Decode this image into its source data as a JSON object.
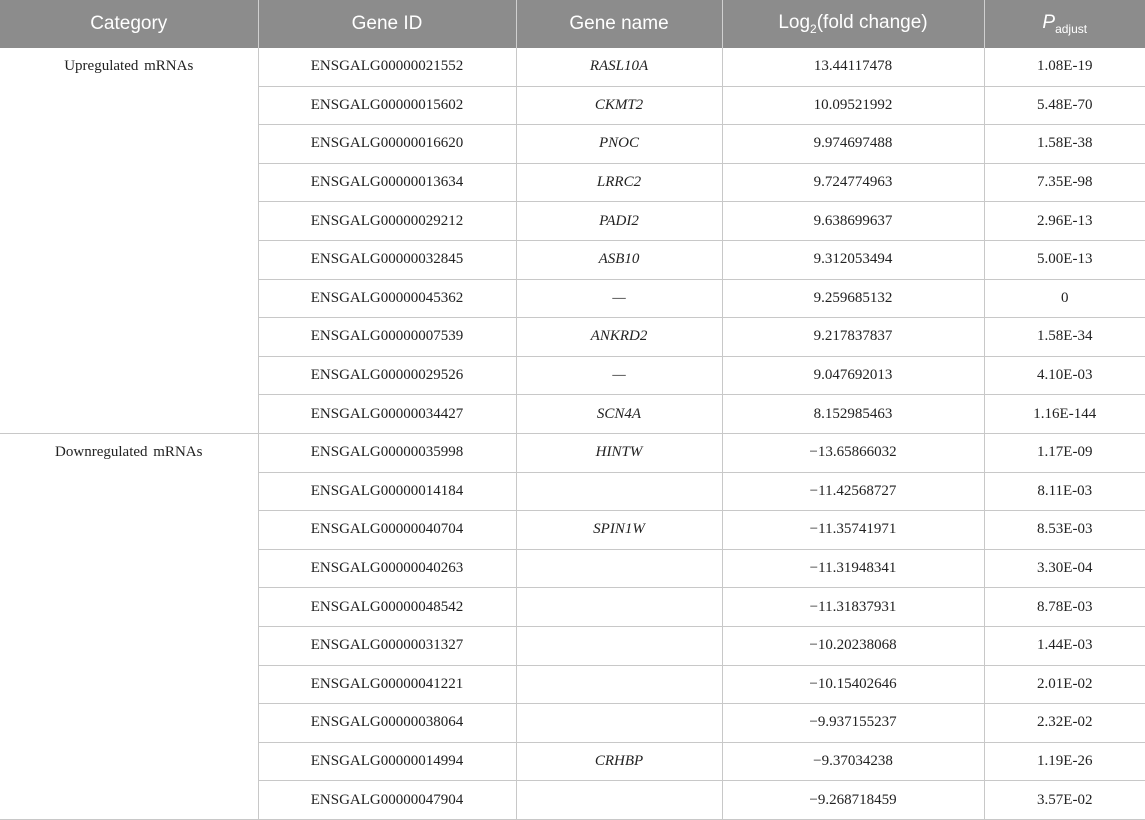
{
  "table": {
    "headers": {
      "category": "Category",
      "gene_id": "Gene ID",
      "gene_name": "Gene name",
      "log2_prefix": "Log",
      "log2_sub": "2",
      "log2_suffix": "(fold change)",
      "padj_main": "P",
      "padj_sub": "adjust"
    },
    "groups": [
      {
        "category": "Upregulated mRNAs",
        "rows": [
          {
            "gene_id": "ENSGALG00000021552",
            "gene_name": "RASL10A",
            "log2fc": "13.44117478",
            "padj": "1.08E-19"
          },
          {
            "gene_id": "ENSGALG00000015602",
            "gene_name": "CKMT2",
            "log2fc": "10.09521992",
            "padj": "5.48E-70"
          },
          {
            "gene_id": "ENSGALG00000016620",
            "gene_name": "PNOC",
            "log2fc": "9.974697488",
            "padj": "1.58E-38"
          },
          {
            "gene_id": "ENSGALG00000013634",
            "gene_name": "LRRC2",
            "log2fc": "9.724774963",
            "padj": "7.35E-98"
          },
          {
            "gene_id": "ENSGALG00000029212",
            "gene_name": "PADI2",
            "log2fc": "9.638699637",
            "padj": "2.96E-13"
          },
          {
            "gene_id": "ENSGALG00000032845",
            "gene_name": "ASB10",
            "log2fc": "9.312053494",
            "padj": "5.00E-13"
          },
          {
            "gene_id": "ENSGALG00000045362",
            "gene_name": "—",
            "log2fc": "9.259685132",
            "padj": "0"
          },
          {
            "gene_id": "ENSGALG00000007539",
            "gene_name": "ANKRD2",
            "log2fc": "9.217837837",
            "padj": "1.58E-34"
          },
          {
            "gene_id": "ENSGALG00000029526",
            "gene_name": "—",
            "log2fc": "9.047692013",
            "padj": "4.10E-03"
          },
          {
            "gene_id": "ENSGALG00000034427",
            "gene_name": "SCN4A",
            "log2fc": "8.152985463",
            "padj": "1.16E-144"
          }
        ]
      },
      {
        "category": "Downregulated mRNAs",
        "rows": [
          {
            "gene_id": "ENSGALG00000035998",
            "gene_name": "HINTW",
            "log2fc": "−13.65866032",
            "padj": "1.17E-09"
          },
          {
            "gene_id": "ENSGALG00000014184",
            "gene_name": "",
            "log2fc": "−11.42568727",
            "padj": "8.11E-03"
          },
          {
            "gene_id": "ENSGALG00000040704",
            "gene_name": "SPIN1W",
            "log2fc": "−11.35741971",
            "padj": "8.53E-03"
          },
          {
            "gene_id": "ENSGALG00000040263",
            "gene_name": "",
            "log2fc": "−11.31948341",
            "padj": "3.30E-04"
          },
          {
            "gene_id": "ENSGALG00000048542",
            "gene_name": "",
            "log2fc": "−11.31837931",
            "padj": "8.78E-03"
          },
          {
            "gene_id": "ENSGALG00000031327",
            "gene_name": "",
            "log2fc": "−10.20238068",
            "padj": "1.44E-03"
          },
          {
            "gene_id": "ENSGALG00000041221",
            "gene_name": "",
            "log2fc": "−10.15402646",
            "padj": "2.01E-02"
          },
          {
            "gene_id": "ENSGALG00000038064",
            "gene_name": "",
            "log2fc": "−9.937155237",
            "padj": "2.32E-02"
          },
          {
            "gene_id": "ENSGALG00000014994",
            "gene_name": "CRHBP",
            "log2fc": "−9.37034238",
            "padj": "1.19E-26"
          },
          {
            "gene_id": "ENSGALG00000047904",
            "gene_name": "",
            "log2fc": "−9.268718459",
            "padj": "3.57E-02"
          }
        ]
      }
    ]
  }
}
